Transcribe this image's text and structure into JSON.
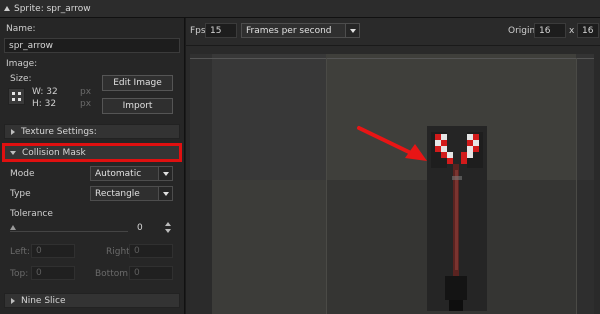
{
  "window": {
    "title": "Sprite: spr_arrow"
  },
  "name": {
    "label": "Name:",
    "value": "spr_arrow"
  },
  "image": {
    "label": "Image:",
    "size_label": "Size:",
    "width": "W: 32",
    "height": "H: 32",
    "unit": "px",
    "edit_button": "Edit Image",
    "import_button": "Import"
  },
  "sections": {
    "texture_settings": "Texture Settings:",
    "collision_mask": "Collision Mask",
    "nine_slice": "Nine Slice"
  },
  "collision": {
    "mode_label": "Mode",
    "mode_value": "Automatic",
    "type_label": "Type",
    "type_value": "Rectangle",
    "tolerance_label": "Tolerance",
    "tolerance_value": "0",
    "left_label": "Left:",
    "left_value": "0",
    "right_label": "Right:",
    "right_value": "0",
    "top_label": "Top:",
    "top_value": "0",
    "bottom_label": "Bottom:",
    "bottom_value": "0"
  },
  "toolbar": {
    "fps_label": "Fps",
    "fps_value": "15",
    "speed_mode": "Frames per second",
    "origin_label": "Origin",
    "origin_x": "16",
    "origin_sep": "x",
    "origin_y": "16"
  },
  "colors": {
    "highlight": "#e01010",
    "arrow": "#e81515"
  },
  "icons": {
    "size_icon": "move-arrows-icon",
    "annotation": "red-arrow-icon"
  }
}
